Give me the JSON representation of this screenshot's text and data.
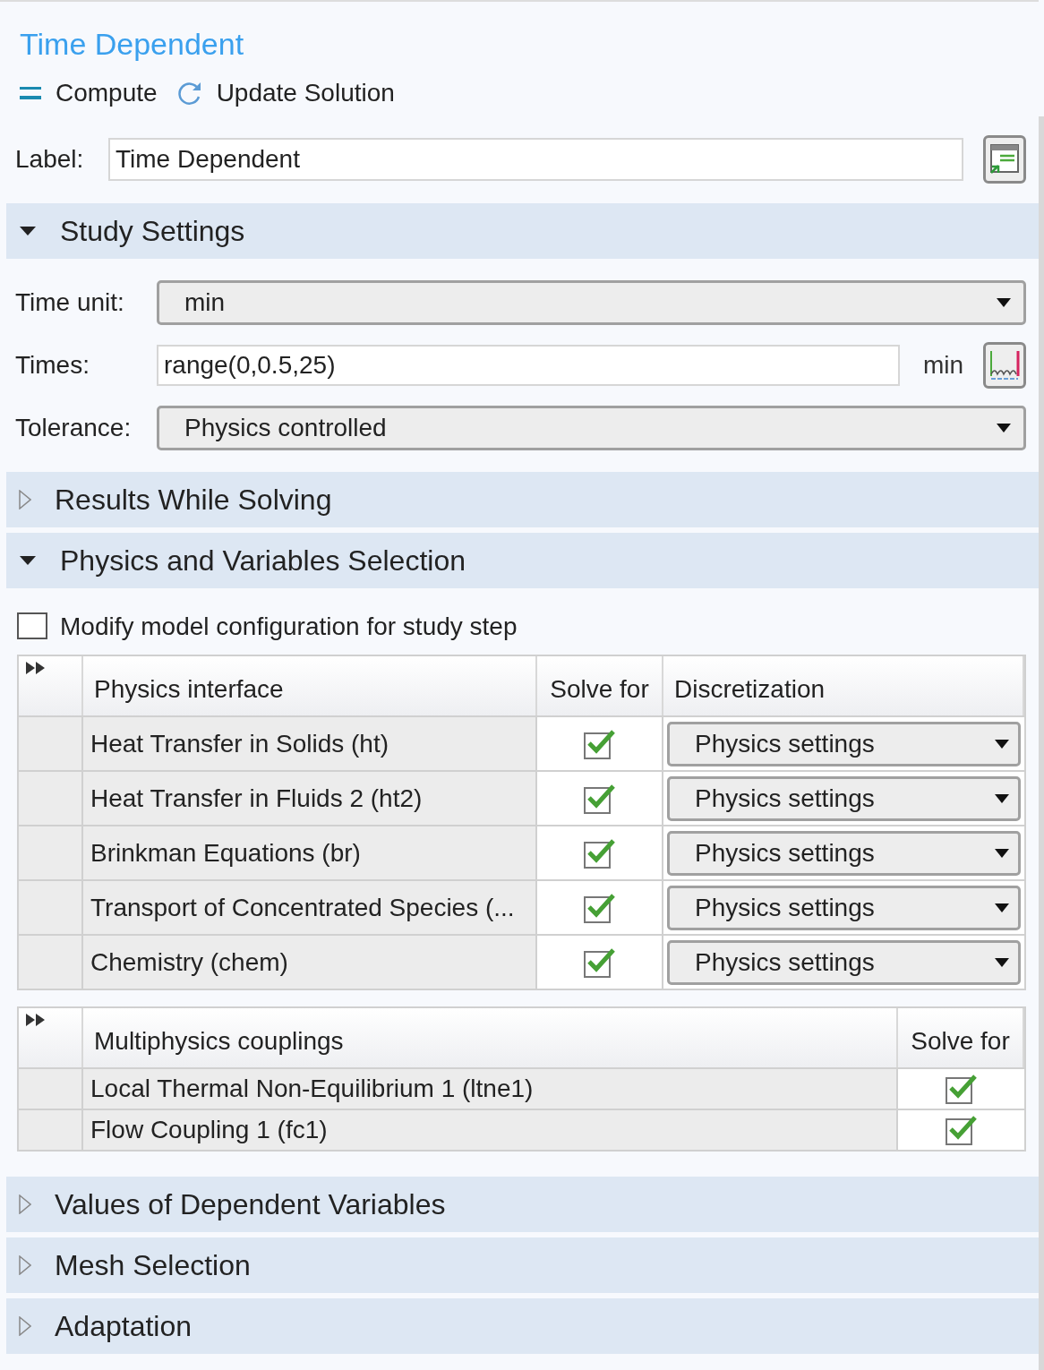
{
  "title": "Time Dependent",
  "toolbar": [
    {
      "kind": "compute",
      "label": "Compute"
    },
    {
      "kind": "update",
      "label": "Update Solution"
    }
  ],
  "label_field": {
    "label": "Label:",
    "value": "Time Dependent"
  },
  "sections": [
    {
      "title": "Study Settings",
      "expanded": true,
      "kind": "study",
      "fields": [
        {
          "kind": "select",
          "label": "Time unit:",
          "value": "min"
        },
        {
          "kind": "input",
          "label": "Times:",
          "value": "range(0,0.5,25)",
          "unit": "min"
        },
        {
          "kind": "select",
          "label": "Tolerance:",
          "value": "Physics controlled"
        }
      ]
    },
    {
      "title": "Results While Solving",
      "expanded": false
    },
    {
      "title": "Physics and Variables Selection",
      "expanded": true,
      "kind": "physics",
      "checkbox": {
        "label": "Modify model configuration for study step",
        "checked": false
      },
      "physics_table": {
        "columns": [
          "Physics interface",
          "Solve for",
          "Discretization"
        ],
        "rows": [
          {
            "name": "Heat Transfer in Solids (ht)",
            "solve_for": true,
            "discretization": "Physics settings"
          },
          {
            "name": "Heat Transfer in Fluids 2 (ht2)",
            "solve_for": true,
            "discretization": "Physics settings"
          },
          {
            "name": "Brinkman Equations (br)",
            "solve_for": true,
            "discretization": "Physics settings"
          },
          {
            "name": "Transport of Concentrated Species (...",
            "solve_for": true,
            "discretization": "Physics settings"
          },
          {
            "name": "Chemistry (chem)",
            "solve_for": true,
            "discretization": "Physics settings"
          }
        ]
      },
      "couplings_table": {
        "columns": [
          "Multiphysics couplings",
          "Solve for"
        ],
        "rows": [
          {
            "name": "Local Thermal Non-Equilibrium 1 (ltne1)",
            "solve_for": true
          },
          {
            "name": "Flow Coupling 1 (fc1)",
            "solve_for": true
          }
        ]
      }
    },
    {
      "title": "Values of Dependent Variables",
      "expanded": false
    },
    {
      "title": "Mesh Selection",
      "expanded": false
    },
    {
      "title": "Adaptation",
      "expanded": false
    }
  ]
}
